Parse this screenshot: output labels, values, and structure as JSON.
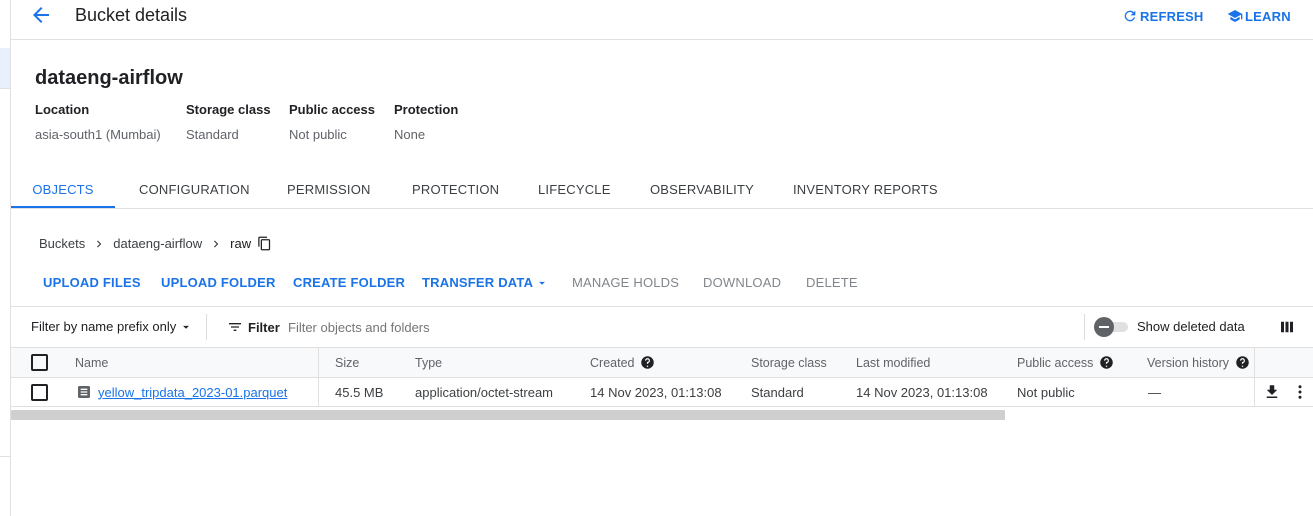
{
  "header": {
    "title": "Bucket details",
    "refresh_label": "REFRESH",
    "learn_label": "LEARN"
  },
  "bucket": {
    "name": "dataeng-airflow",
    "meta": [
      {
        "key": "Location",
        "value": "asia-south1 (Mumbai)"
      },
      {
        "key": "Storage class",
        "value": "Standard"
      },
      {
        "key": "Public access",
        "value": "Not public"
      },
      {
        "key": "Protection",
        "value": "None"
      }
    ]
  },
  "tabs": [
    "OBJECTS",
    "CONFIGURATION",
    "PERMISSION",
    "PROTECTION",
    "LIFECYCLE",
    "OBSERVABILITY",
    "INVENTORY REPORTS"
  ],
  "breadcrumb": [
    "Buckets",
    "dataeng-airflow",
    "raw"
  ],
  "actions": {
    "upload_files": "UPLOAD FILES",
    "upload_folder": "UPLOAD FOLDER",
    "create_folder": "CREATE FOLDER",
    "transfer_data": "TRANSFER DATA",
    "manage_holds": "MANAGE HOLDS",
    "download": "DOWNLOAD",
    "delete": "DELETE"
  },
  "filter": {
    "mode": "Filter by name prefix only",
    "label": "Filter",
    "placeholder": "Filter objects and folders",
    "show_deleted": "Show deleted data"
  },
  "table": {
    "columns": [
      "Name",
      "Size",
      "Type",
      "Created",
      "Storage class",
      "Last modified",
      "Public access",
      "Version history"
    ],
    "rows": [
      {
        "name": "yellow_tripdata_2023-01.parquet",
        "size": "45.5 MB",
        "type": "application/octet-stream",
        "created": "14 Nov 2023, 01:13:08",
        "storage_class": "Standard",
        "last_modified": "14 Nov 2023, 01:13:08",
        "public_access": "Not public",
        "version_history": "—"
      }
    ]
  },
  "colors": {
    "accent": "#1a73e8",
    "text": "#202124",
    "muted": "#5f6368"
  }
}
